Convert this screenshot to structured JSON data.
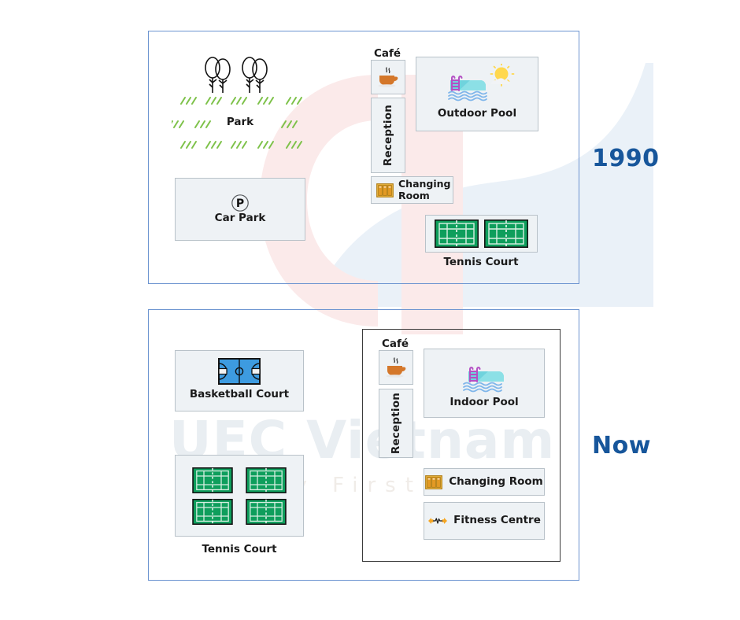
{
  "eras": {
    "past": {
      "label": "1990",
      "color": "#17569b"
    },
    "present": {
      "label": "Now",
      "color": "#17569b"
    }
  },
  "watermark": {
    "brand": "UEC Vietnam",
    "tagline": "Quality First"
  },
  "diagram_1990": {
    "park": {
      "label": "Park",
      "icon": "trees-icon",
      "grass_icon": "grass-tufts-icon"
    },
    "car_park": {
      "label": "Car Park",
      "icon": "parking-p-icon"
    },
    "cafe": {
      "label": "Café",
      "icon": "coffee-cup-icon"
    },
    "reception": {
      "label": "Reception"
    },
    "changing_room": {
      "label": "Changing\nRoom",
      "label_line1": "Changing",
      "label_line2": "Room",
      "icon": "lockers-icon"
    },
    "outdoor_pool": {
      "label": "Outdoor Pool",
      "icon": "swimming-pool-sun-icon"
    },
    "tennis": {
      "label": "Tennis Court",
      "icon": "tennis-court-icon",
      "count": 2
    }
  },
  "diagram_now": {
    "basketball": {
      "label": "Basketball Court",
      "icon": "basketball-court-icon"
    },
    "tennis": {
      "label": "Tennis Court",
      "icon": "tennis-court-icon",
      "count": 4
    },
    "cafe": {
      "label": "Café",
      "icon": "coffee-cup-icon"
    },
    "reception": {
      "label": "Reception"
    },
    "indoor_pool": {
      "label": "Indoor Pool",
      "icon": "swimming-pool-icon"
    },
    "changing_room": {
      "label": "Changing Room",
      "icon": "lockers-icon"
    },
    "fitness_centre": {
      "label": "Fitness Centre",
      "icon": "dumbbell-icon"
    }
  },
  "colors": {
    "frame_border": "#6b93d0",
    "box_fill": "#eef2f5",
    "box_border": "#b9c2c9",
    "tennis_green": "#0e9e5c",
    "basketball_blue": "#3d9be0",
    "pool_cyan": "#6fd3dd",
    "locker_orange": "#f0a830",
    "coffee_orange": "#d4772a",
    "era_blue": "#17569b"
  }
}
